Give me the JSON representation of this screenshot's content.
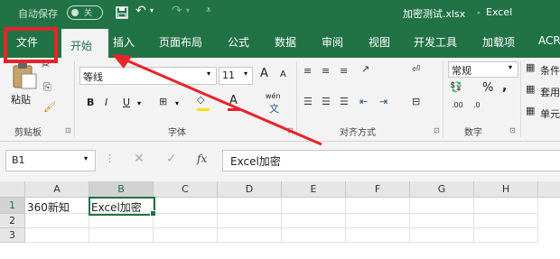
{
  "titlebar": {
    "autosave_label": "自动保存",
    "autosave_state": "关",
    "undo_icon": "↶",
    "redo_icon": "↷",
    "doc_title": "加密测试.xlsx",
    "separator": "-",
    "app_name": "Excel"
  },
  "tabs": [
    "文件",
    "开始",
    "插入",
    "页面布局",
    "公式",
    "数据",
    "审阅",
    "视图",
    "开发工具",
    "加载项",
    "ACR"
  ],
  "ribbon": {
    "clipboard": {
      "paste_label": "粘贴",
      "group_label": "剪贴板"
    },
    "font": {
      "font_name": "等线",
      "font_size": "11",
      "grow": "A",
      "shrink": "A",
      "bold": "B",
      "italic": "I",
      "underline": "U",
      "font_color": "A",
      "phonetic": "wén",
      "group_label": "字体"
    },
    "alignment": {
      "group_label": "对齐方式"
    },
    "number": {
      "format": "常规",
      "percent": "%",
      "comma": ",",
      "inc": ".00",
      "dec": ".0",
      "group_label": "数字"
    },
    "styles": {
      "cond": "条件",
      "table": "套用",
      "cell": "单元"
    }
  },
  "formula_bar": {
    "name_box": "B1",
    "fx": "fx",
    "content": "Excel加密"
  },
  "grid": {
    "columns": [
      "A",
      "B",
      "C",
      "D",
      "E",
      "F",
      "G",
      "H"
    ],
    "rows": [
      "1",
      "2",
      "3"
    ],
    "cells": {
      "A1": "360新知",
      "B1": "Excel加密"
    }
  },
  "colors": {
    "accent": "#217346",
    "highlight": "#e8232a"
  }
}
